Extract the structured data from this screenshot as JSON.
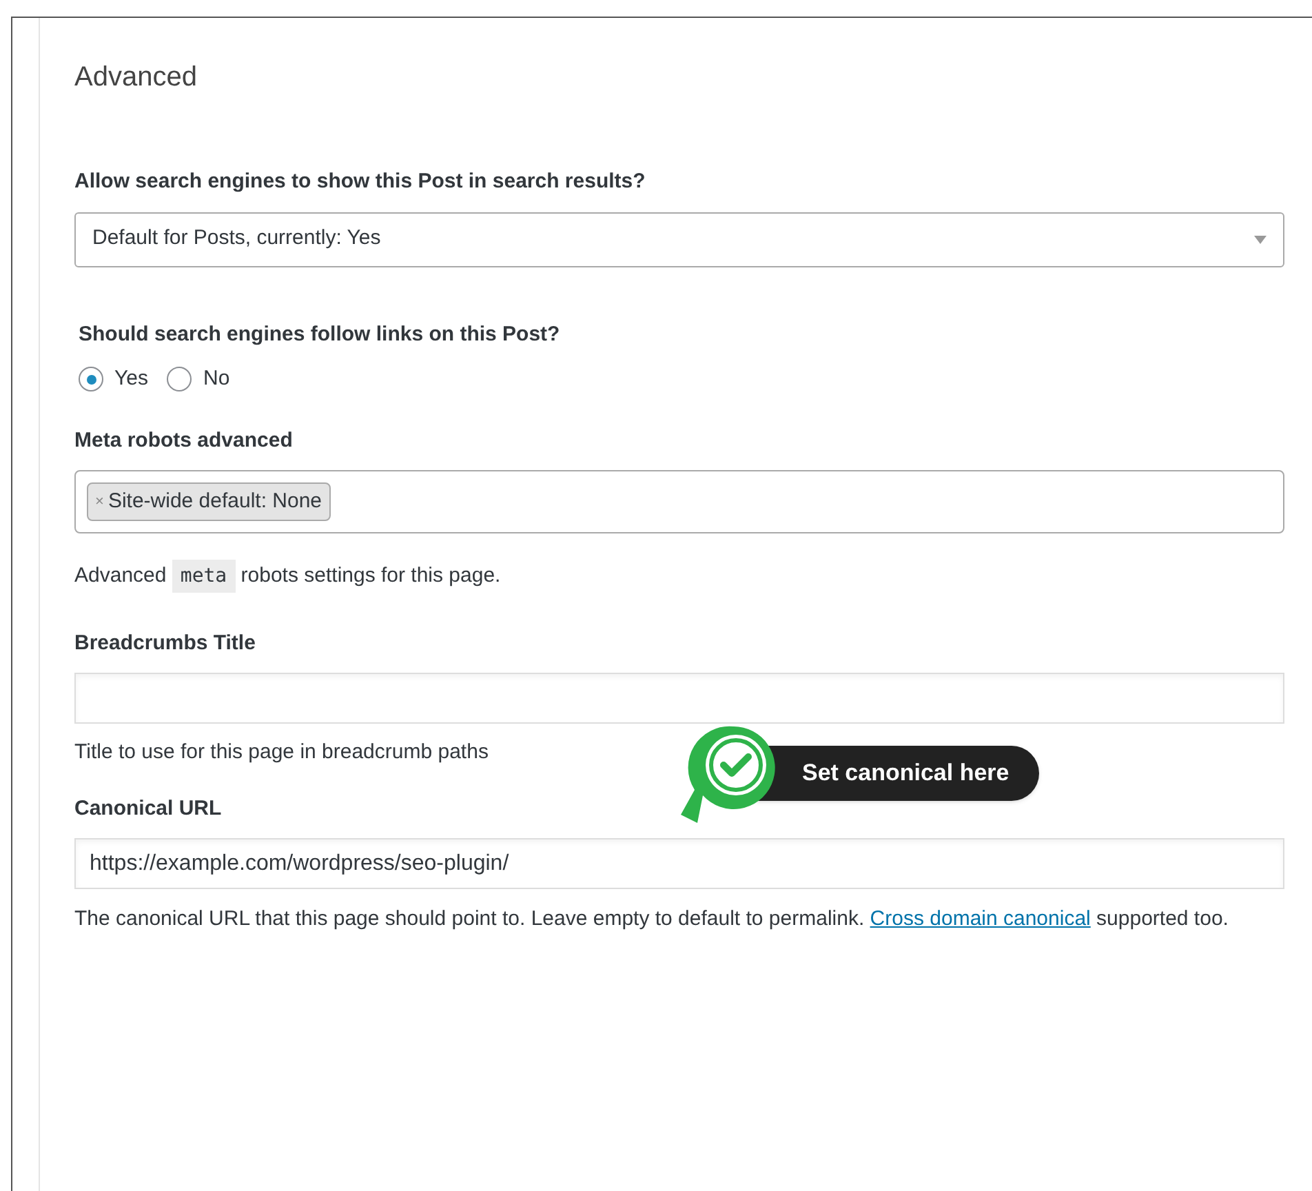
{
  "panel": {
    "title": "Advanced"
  },
  "fields": [
    {
      "kind": "select",
      "label": "Allow search engines to show this Post in search results?",
      "value": "Default for Posts, currently: Yes"
    },
    {
      "kind": "radio",
      "label": "Should search engines follow links on this Post?",
      "options": [
        {
          "label": "Yes",
          "selected": true
        },
        {
          "label": "No",
          "selected": false
        }
      ]
    },
    {
      "kind": "tags",
      "label": "Meta robots advanced",
      "tags": [
        "Site-wide default: None"
      ],
      "remove_glyph": "×",
      "help_parts": [
        "Advanced",
        "meta",
        "robots settings for this page."
      ]
    },
    {
      "kind": "text",
      "label": "Breadcrumbs Title",
      "help": "Title to use for this page in breadcrumb paths"
    },
    {
      "kind": "text",
      "label": "Canonical URL",
      "value": "https://example.com/wordpress/seo-plugin/",
      "help": "The canonical URL that this page should point to. Leave empty to default to permalink.",
      "help_link": "Cross domain canonical",
      "help_after": "supported too.",
      "callout": "Set canonical here"
    }
  ]
}
